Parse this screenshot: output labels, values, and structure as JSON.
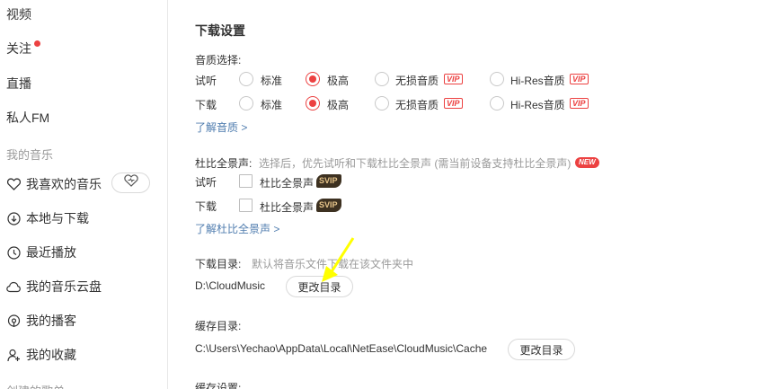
{
  "sidebar": {
    "items": [
      {
        "label": "视频"
      },
      {
        "label": "关注"
      },
      {
        "label": "直播"
      },
      {
        "label": "私人FM"
      }
    ],
    "section_my_music": "我的音乐",
    "my_music": [
      {
        "label": "我喜欢的音乐",
        "icon": "heart-icon"
      },
      {
        "label": "本地与下载",
        "icon": "download-icon"
      },
      {
        "label": "最近播放",
        "icon": "clock-icon"
      },
      {
        "label": "我的音乐云盘",
        "icon": "cloud-icon"
      },
      {
        "label": "我的播客",
        "icon": "podcast-icon"
      },
      {
        "label": "我的收藏",
        "icon": "collect-icon"
      }
    ],
    "section_created": "创建的歌单",
    "accent_color": "#ec4141"
  },
  "download": {
    "title": "下载设置",
    "quality_label": "音质选择:",
    "rows": [
      {
        "label": "试听",
        "options": [
          "标准",
          "极高",
          "无损音质",
          "Hi-Res音质"
        ],
        "selected": 1
      },
      {
        "label": "下载",
        "options": [
          "标准",
          "极高",
          "无损音质",
          "Hi-Res音质"
        ],
        "selected": 1
      }
    ],
    "vip_text": "VIP",
    "learn_quality": "了解音质 >",
    "dolby_label": "杜比全景声:",
    "dolby_desc": "选择后，优先试听和下载杜比全景声 (需当前设备支持杜比全景声)",
    "new_badge": "NEW",
    "dolby_rows": [
      {
        "label": "试听",
        "option": "杜比全景声",
        "checked": false
      },
      {
        "label": "下载",
        "option": "杜比全景声",
        "checked": false
      }
    ],
    "svip_text": "SVIP",
    "learn_dolby": "了解杜比全景声 >",
    "dir_label": "下载目录:",
    "dir_desc": "默认将音乐文件下载在该文件夹中",
    "dir_path": "D:\\CloudMusic",
    "change_dir": "更改目录",
    "cache_label": "缓存目录:",
    "cache_path": "C:\\Users\\Yechao\\AppData\\Local\\NetEase\\CloudMusic\\Cache",
    "cache_change": "更改目录",
    "cache_settings": "缓存设置:"
  }
}
